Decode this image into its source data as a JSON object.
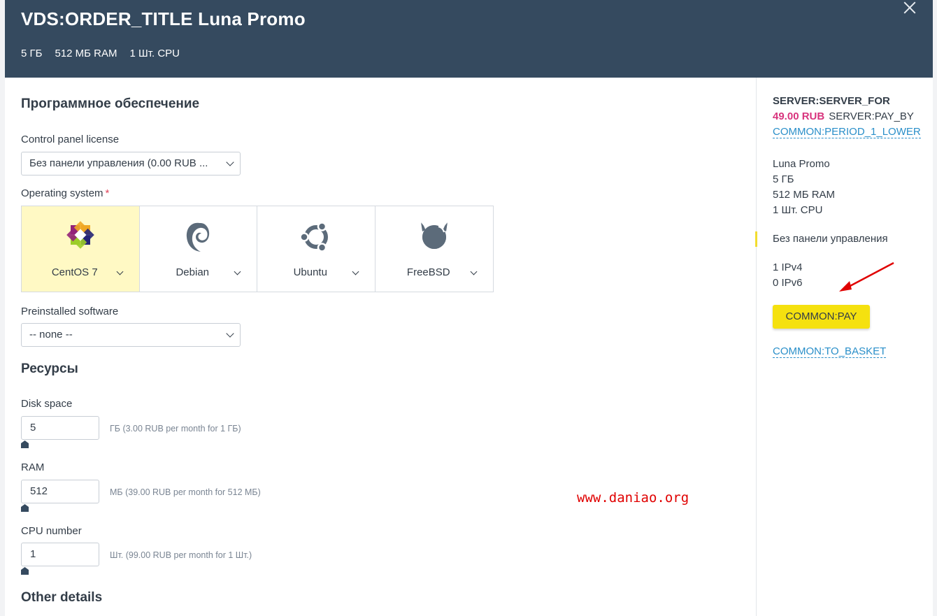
{
  "header": {
    "title": "VDS:ORDER_TITLE Luna Promo",
    "specs": [
      "5 ГБ",
      "512 МБ RAM",
      "1 Шт. CPU"
    ],
    "close_icon": "close-icon",
    "background_color": "#354a5f"
  },
  "software": {
    "heading": "Программное обеспечение",
    "panel_label": "Control panel license",
    "panel_value": "Без панели управления (0.00 RUB ...",
    "os_label": "Operating system",
    "os_required_mark": "*",
    "os_options": [
      {
        "name": "CentOS 7",
        "icon": "centos-icon",
        "selected": true
      },
      {
        "name": "Debian",
        "icon": "debian-icon",
        "selected": false
      },
      {
        "name": "Ubuntu",
        "icon": "ubuntu-icon",
        "selected": false
      },
      {
        "name": "FreeBSD",
        "icon": "freebsd-icon",
        "selected": false
      }
    ],
    "preinstalled_label": "Preinstalled software",
    "preinstalled_value": "-- none --"
  },
  "resources": {
    "heading": "Ресурсы",
    "disk": {
      "label": "Disk space",
      "value": "5",
      "hint": "ГБ (3.00 RUB per month for 1 ГБ)",
      "slider_level": 0
    },
    "ram": {
      "label": "RAM",
      "value": "512",
      "hint": "МБ (39.00 RUB per month for 512 МБ)",
      "slider_level": 0
    },
    "cpu": {
      "label": "CPU number",
      "value": "1",
      "hint": "Шт. (99.00 RUB per month for 1 Шт.)",
      "slider_level": 0
    }
  },
  "other": {
    "heading": "Other details"
  },
  "watermark": "www.daniao.org",
  "sidebar": {
    "title": "SERVER:SERVER_FOR",
    "price": "49.00 RUB",
    "pay_by": "SERVER:PAY_BY",
    "period_link": "COMMON:PERIOD_1_LOWER",
    "summary": [
      "Luna Promo",
      "5 ГБ",
      "512 МБ RAM",
      "1 Шт. CPU"
    ],
    "panel": "Без панели управления",
    "ips": [
      "1 IPv4",
      "0 IPv6"
    ],
    "pay_button": "COMMON:PAY",
    "basket_link": "COMMON:TO_BASKET"
  },
  "colors": {
    "accent_yellow": "#f5e10f",
    "selected_card": "#fff9c4",
    "price_pink": "#d8347d",
    "link_blue": "#2a8fc9",
    "annotation_red": "#e00000"
  }
}
